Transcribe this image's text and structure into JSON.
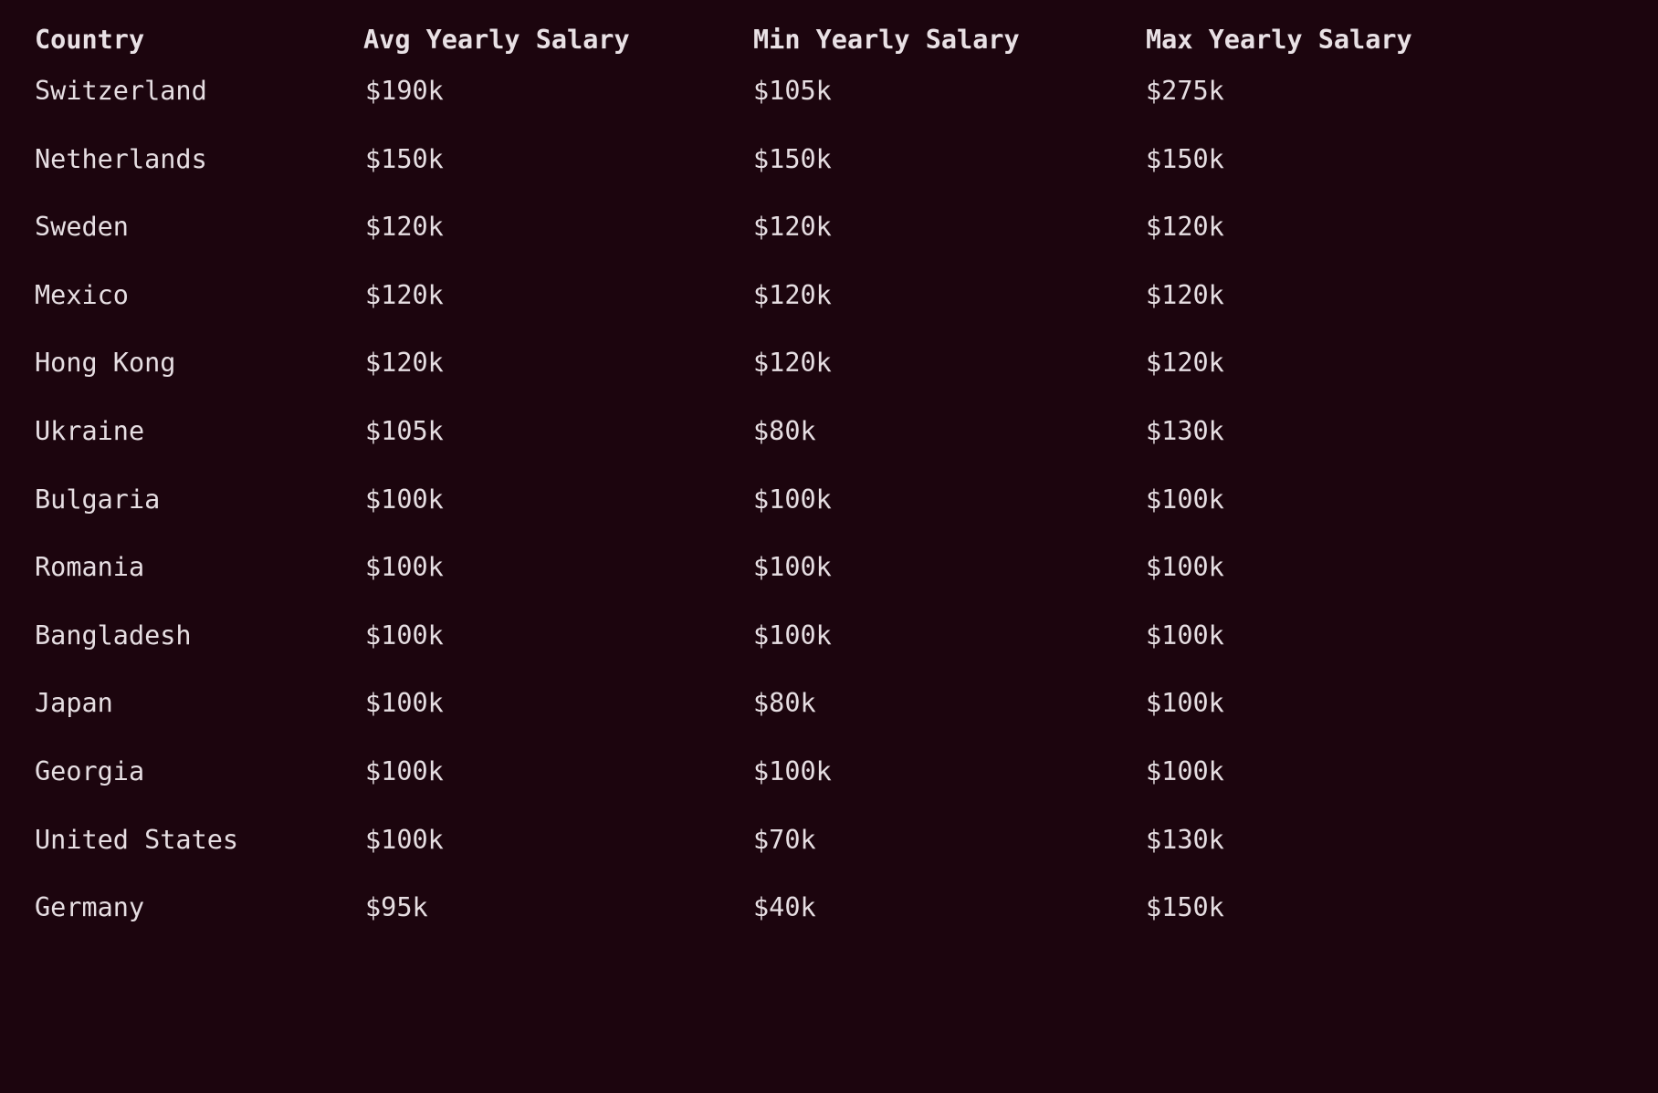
{
  "table": {
    "columns": [
      {
        "key": "country",
        "label": "Country",
        "align": "left"
      },
      {
        "key": "avg",
        "label": "Avg Yearly Salary",
        "align": "left"
      },
      {
        "key": "min",
        "label": "Min Yearly Salary",
        "align": "left"
      },
      {
        "key": "max",
        "label": "Max Yearly Salary",
        "align": "left"
      }
    ],
    "rows": [
      {
        "country": "Switzerland",
        "avg": "$190k",
        "min": "$105k",
        "max": "$275k"
      },
      {
        "country": "Netherlands",
        "avg": "$150k",
        "min": "$150k",
        "max": "$150k"
      },
      {
        "country": "Sweden",
        "avg": "$120k",
        "min": "$120k",
        "max": "$120k"
      },
      {
        "country": "Mexico",
        "avg": "$120k",
        "min": "$120k",
        "max": "$120k"
      },
      {
        "country": "Hong Kong",
        "avg": "$120k",
        "min": "$120k",
        "max": "$120k"
      },
      {
        "country": "Ukraine",
        "avg": "$105k",
        "min": "$80k",
        "max": "$130k"
      },
      {
        "country": "Bulgaria",
        "avg": "$100k",
        "min": "$100k",
        "max": "$100k"
      },
      {
        "country": "Romania",
        "avg": "$100k",
        "min": "$100k",
        "max": "$100k"
      },
      {
        "country": "Bangladesh",
        "avg": "$100k",
        "min": "$100k",
        "max": "$100k"
      },
      {
        "country": "Japan",
        "avg": "$100k",
        "min": "$80k",
        "max": "$100k"
      },
      {
        "country": "Georgia",
        "avg": "$100k",
        "min": "$100k",
        "max": "$100k"
      },
      {
        "country": "United States",
        "avg": "$100k",
        "min": "$70k",
        "max": "$130k"
      },
      {
        "country": "Germany",
        "avg": "$95k",
        "min": "$40k",
        "max": "$150k"
      }
    ]
  },
  "chart_data": {
    "type": "table",
    "title": "",
    "columns": [
      "Country",
      "Avg Yearly Salary",
      "Min Yearly Salary",
      "Max Yearly Salary"
    ],
    "units": "USD",
    "value_suffix": "k",
    "categories": [
      "Switzerland",
      "Netherlands",
      "Sweden",
      "Mexico",
      "Hong Kong",
      "Ukraine",
      "Bulgaria",
      "Romania",
      "Bangladesh",
      "Japan",
      "Georgia",
      "United States",
      "Germany"
    ],
    "series": [
      {
        "name": "Avg Yearly Salary",
        "values": [
          190,
          150,
          120,
          120,
          120,
          105,
          100,
          100,
          100,
          100,
          100,
          100,
          95
        ]
      },
      {
        "name": "Min Yearly Salary",
        "values": [
          105,
          150,
          120,
          120,
          120,
          80,
          100,
          100,
          100,
          80,
          100,
          70,
          40
        ]
      },
      {
        "name": "Max Yearly Salary",
        "values": [
          275,
          150,
          120,
          120,
          120,
          130,
          100,
          100,
          100,
          100,
          100,
          130,
          150
        ]
      }
    ],
    "rows": [
      [
        "Switzerland",
        "$190k",
        "$105k",
        "$275k"
      ],
      [
        "Netherlands",
        "$150k",
        "$150k",
        "$150k"
      ],
      [
        "Sweden",
        "$120k",
        "$120k",
        "$120k"
      ],
      [
        "Mexico",
        "$120k",
        "$120k",
        "$120k"
      ],
      [
        "Hong Kong",
        "$120k",
        "$120k",
        "$120k"
      ],
      [
        "Ukraine",
        "$105k",
        "$80k",
        "$130k"
      ],
      [
        "Bulgaria",
        "$100k",
        "$100k",
        "$100k"
      ],
      [
        "Romania",
        "$100k",
        "$100k",
        "$100k"
      ],
      [
        "Bangladesh",
        "$100k",
        "$100k",
        "$100k"
      ],
      [
        "Japan",
        "$100k",
        "$80k",
        "$100k"
      ],
      [
        "Georgia",
        "$100k",
        "$100k",
        "$100k"
      ],
      [
        "United States",
        "$100k",
        "$70k",
        "$130k"
      ],
      [
        "Germany",
        "$95k",
        "$40k",
        "$150k"
      ]
    ],
    "xlabel": "",
    "ylabel": "",
    "grid": false,
    "legend": "none"
  },
  "theme": {
    "background": "#1c050e",
    "header_text": "#e9e1e5",
    "body_text": "#e6dee2"
  }
}
